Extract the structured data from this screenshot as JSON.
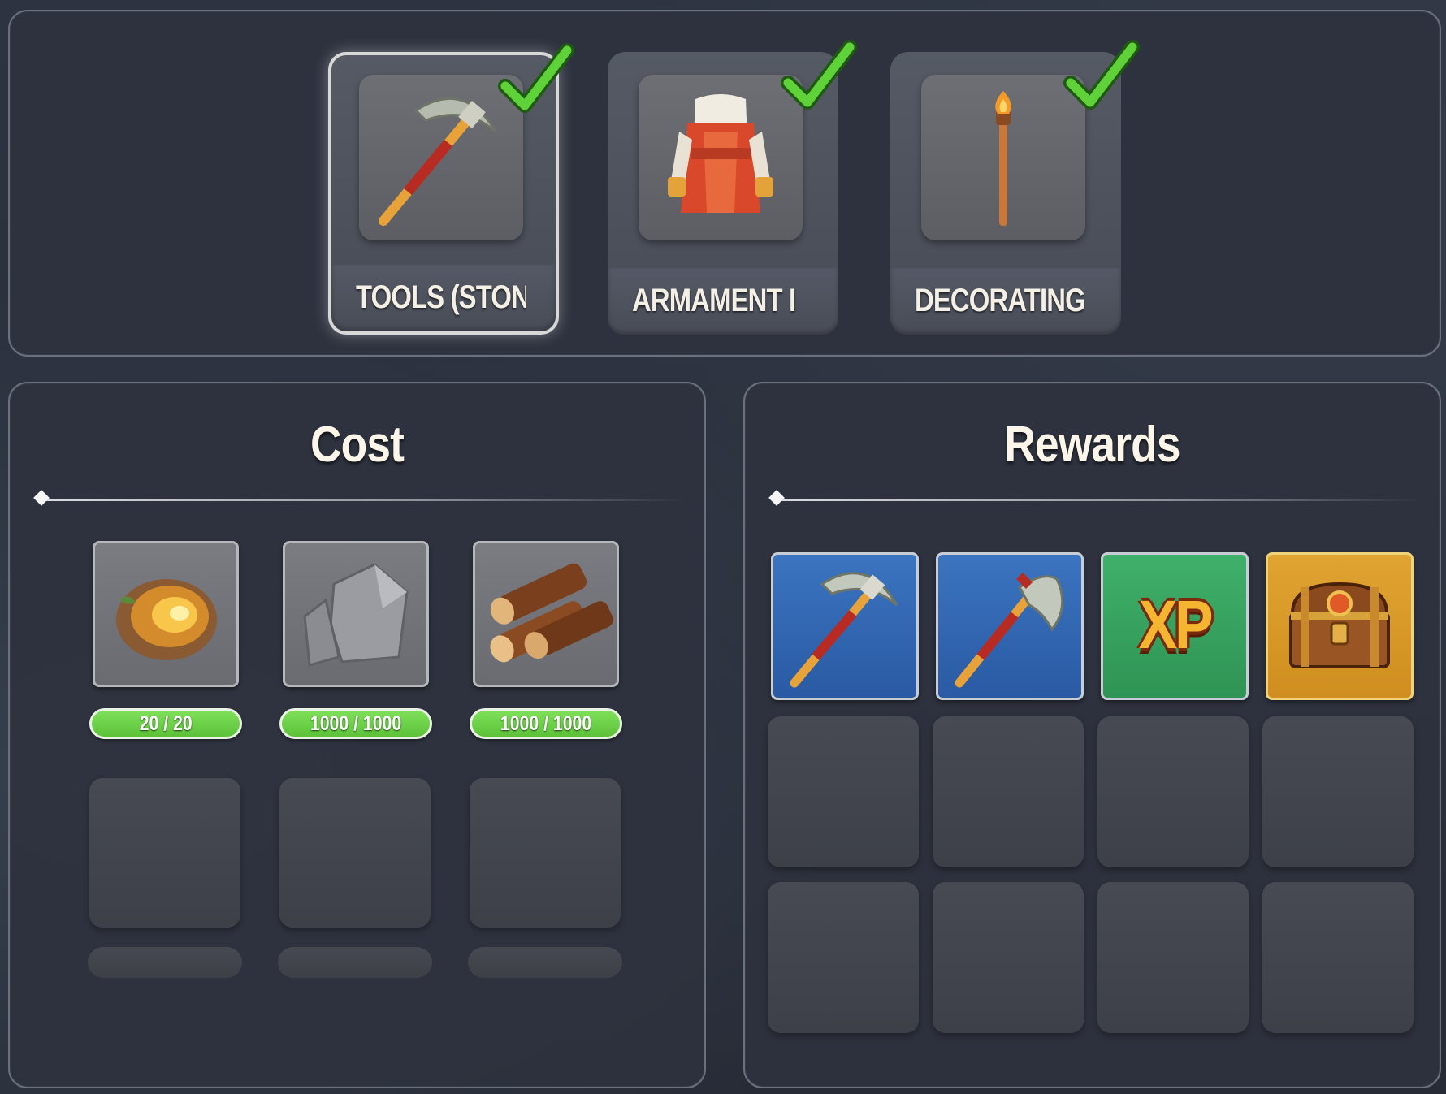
{
  "recipes": [
    {
      "label": "TOOLS (STONE)",
      "icon": "pickaxe-icon",
      "selected": true,
      "completed": true
    },
    {
      "label": "ARMAMENT I",
      "icon": "armor-icon",
      "selected": false,
      "completed": true
    },
    {
      "label": "DECORATING I",
      "icon": "torch-icon",
      "selected": false,
      "completed": true
    }
  ],
  "cost": {
    "title": "Cost",
    "items": [
      {
        "icon": "gold-ore-icon",
        "quantity": "20 / 20"
      },
      {
        "icon": "stone-icon",
        "quantity": "1000 / 1000"
      },
      {
        "icon": "wood-logs-icon",
        "quantity": "1000 / 1000"
      }
    ]
  },
  "rewards": {
    "title": "Rewards",
    "items": [
      {
        "icon": "pickaxe-icon",
        "rarity_color": "#3265b1"
      },
      {
        "icon": "axe-icon",
        "rarity_color": "#3265b1"
      },
      {
        "icon": "xp-icon",
        "label": "XP",
        "rarity_color": "#35a05e"
      },
      {
        "icon": "treasure-chest-icon",
        "rarity_color": "#d89a28"
      }
    ]
  },
  "colors": {
    "check": "#5fd23a",
    "qty_pill": "#6ad046",
    "panel_border": "#6b707d"
  }
}
